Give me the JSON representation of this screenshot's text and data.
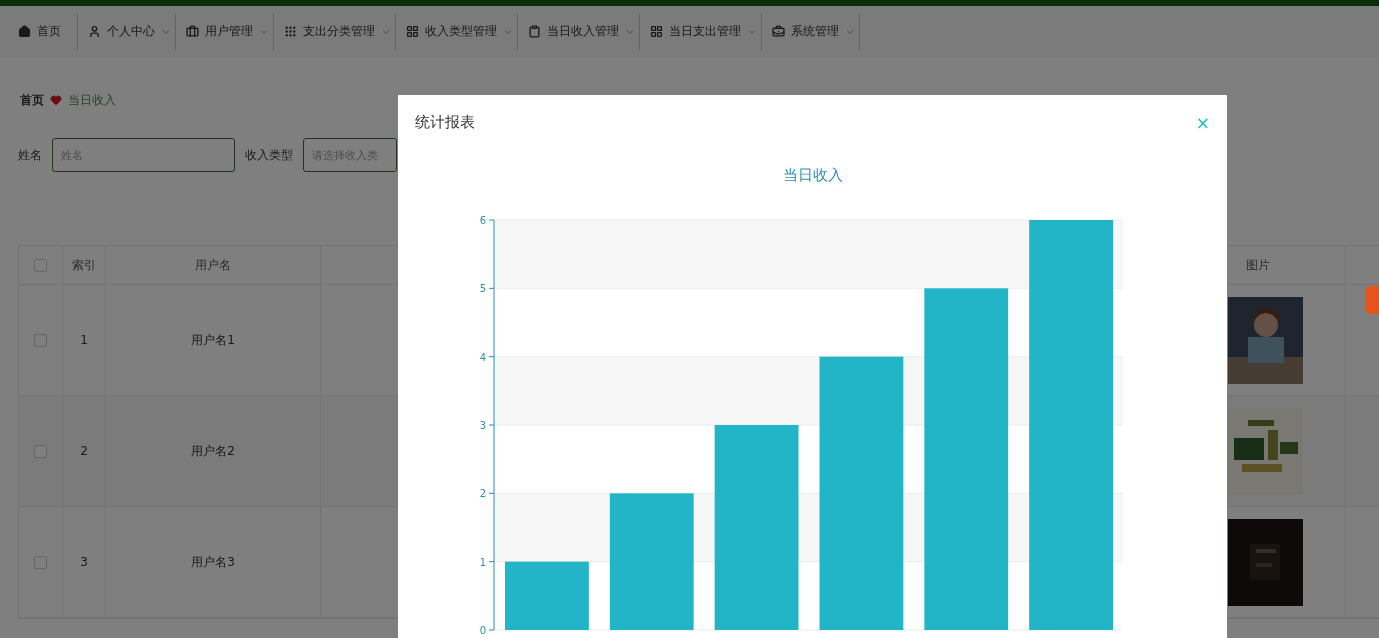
{
  "nav": [
    {
      "label": "首页",
      "dropdown": false
    },
    {
      "label": "个人中心",
      "dropdown": true
    },
    {
      "label": "用户管理",
      "dropdown": true
    },
    {
      "label": "支出分类管理",
      "dropdown": true
    },
    {
      "label": "收入类型管理",
      "dropdown": true
    },
    {
      "label": "当日收入管理",
      "dropdown": true
    },
    {
      "label": "当日支出管理",
      "dropdown": true
    },
    {
      "label": "系统管理",
      "dropdown": true
    }
  ],
  "breadcrumb": {
    "home": "首页",
    "current": "当日收入"
  },
  "search": [
    {
      "label": "姓名",
      "placeholder": "姓名"
    },
    {
      "label": "收入类型",
      "placeholder": "请选择收入类"
    }
  ],
  "table": {
    "select_all": false,
    "columns": {
      "index": "索引",
      "username": "用户名",
      "image": "图片"
    },
    "rows": [
      {
        "checked": false,
        "index": "1",
        "username": "用户名1"
      },
      {
        "checked": false,
        "index": "2",
        "username": "用户名2"
      },
      {
        "checked": false,
        "index": "3",
        "username": "用户名3"
      }
    ]
  },
  "modal": {
    "title": "统计报表",
    "close": "×",
    "chart_data": {
      "type": "bar",
      "title": "当日收入",
      "values": [
        1,
        2,
        3,
        4,
        5,
        6
      ],
      "ylim": [
        0,
        6
      ],
      "grid": true,
      "yticks": [
        0,
        1,
        2,
        3,
        4,
        5,
        6
      ]
    }
  }
}
